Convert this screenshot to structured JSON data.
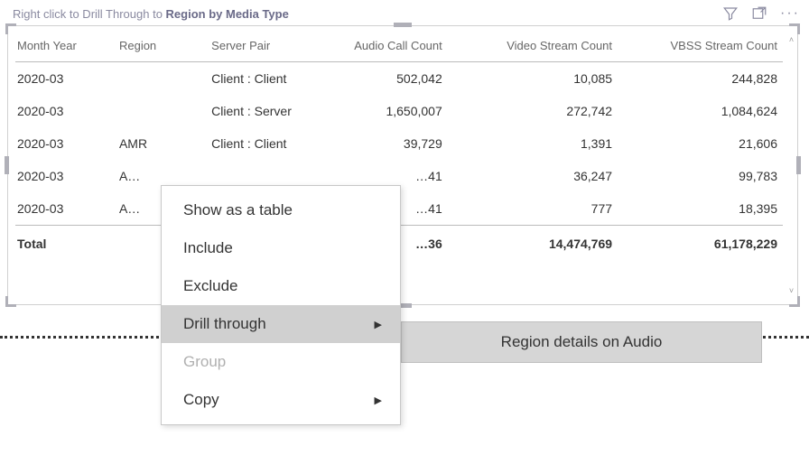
{
  "title": {
    "prefix": "Right click to Drill Through to ",
    "bold": "Region by Media Type"
  },
  "columns": {
    "month_year": "Month Year",
    "region": "Region",
    "server_pair": "Server Pair",
    "audio": "Audio Call Count",
    "video": "Video Stream Count",
    "vbss": "VBSS Stream Count"
  },
  "rows": [
    {
      "month_year": "2020-03",
      "region": "",
      "server_pair": "Client : Client",
      "audio": "502,042",
      "video": "10,085",
      "vbss": "244,828"
    },
    {
      "month_year": "2020-03",
      "region": "",
      "server_pair": "Client : Server",
      "audio": "1,650,007",
      "video": "272,742",
      "vbss": "1,084,624"
    },
    {
      "month_year": "2020-03",
      "region": "AMR",
      "server_pair": "Client : Client",
      "audio": "39,729",
      "video": "1,391",
      "vbss": "21,606"
    },
    {
      "month_year": "2020-03",
      "region": "A…",
      "server_pair": "",
      "audio": "…41",
      "video": "36,247",
      "vbss": "99,783"
    },
    {
      "month_year": "2020-03",
      "region": "A…",
      "server_pair": "",
      "audio": "…41",
      "video": "777",
      "vbss": "18,395"
    }
  ],
  "total": {
    "label": "Total",
    "audio": "…36",
    "video": "14,474,769",
    "vbss": "61,178,229"
  },
  "context_menu": {
    "show_as_table": "Show as a table",
    "include": "Include",
    "exclude": "Exclude",
    "drill_through": "Drill through",
    "group": "Group",
    "copy": "Copy"
  },
  "submenu": {
    "region_details": "Region details on Audio"
  }
}
